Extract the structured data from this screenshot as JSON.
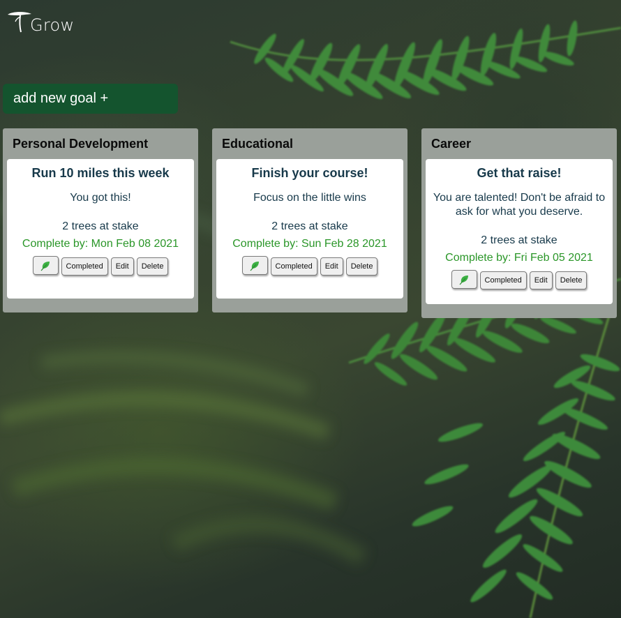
{
  "app": {
    "title": "Grow",
    "add_goal_label": "add new goal +"
  },
  "icons": {
    "logo": "tree-icon",
    "leaf": "leaf-icon"
  },
  "colors": {
    "add_goal_bg": "#14542e",
    "column_bg": "#9aa09a",
    "card_text": "#17394a",
    "due_text": "#2a9628"
  },
  "columns": [
    {
      "title": "Personal Development",
      "goal": {
        "title": "Run 10 miles this week",
        "message": "You got this!",
        "stake": "2 trees at stake",
        "due": "Complete by: Mon Feb 08 2021",
        "completed_label": "Completed",
        "edit_label": "Edit",
        "delete_label": "Delete"
      }
    },
    {
      "title": "Educational",
      "goal": {
        "title": "Finish your course!",
        "message": "Focus on the little wins",
        "stake": "2 trees at stake",
        "due": "Complete by: Sun Feb 28 2021",
        "completed_label": "Completed",
        "edit_label": "Edit",
        "delete_label": "Delete"
      }
    },
    {
      "title": "Career",
      "goal": {
        "title": "Get that raise!",
        "message": "You are talented! Don't be afraid to ask for what you deserve.",
        "stake": "2 trees at stake",
        "due": "Complete by: Fri Feb 05 2021",
        "completed_label": "Completed",
        "edit_label": "Edit",
        "delete_label": "Delete"
      }
    }
  ]
}
